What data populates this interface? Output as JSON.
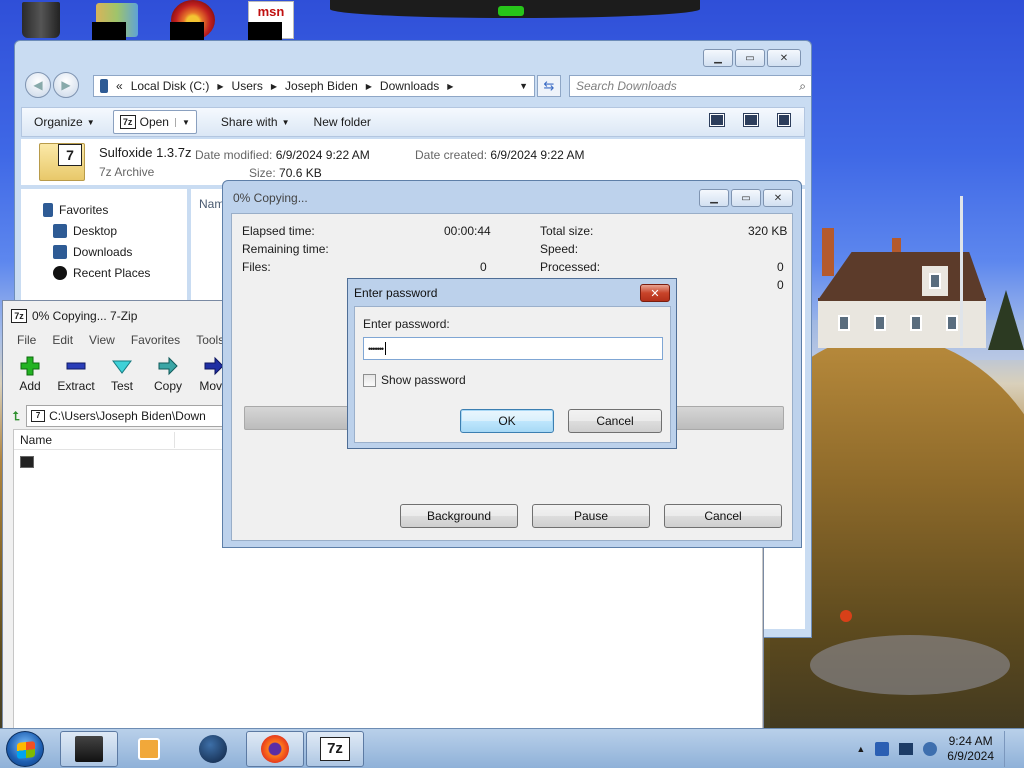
{
  "desktop": {
    "icons": [
      "recycle-bin",
      "books",
      "media-player",
      "msn"
    ],
    "msn_label": "msn"
  },
  "explorer": {
    "breadcrumbs": [
      "Local Disk (C:)",
      "Users",
      "Joseph Biden",
      "Downloads"
    ],
    "breadcrumb_prefix": "«",
    "search_placeholder": "Search Downloads",
    "commands": {
      "organize": "Organize",
      "open": "Open",
      "share_with": "Share with",
      "new_folder": "New folder"
    },
    "file": {
      "name": "Sulfoxide 1.3.7z",
      "type": "7z Archive",
      "date_modified_label": "Date modified:",
      "date_modified": "6/9/2024 9:22 AM",
      "date_created_label": "Date created:",
      "date_created": "6/9/2024 9:22 AM",
      "size_label": "Size:",
      "size": "70.6 KB"
    },
    "nav": {
      "favorites": "Favorites",
      "desktop": "Desktop",
      "downloads": "Downloads",
      "recent_places": "Recent Places"
    },
    "list_column": "Nam"
  },
  "zip_fm": {
    "title": "0% Copying... 7-Zip",
    "menu": [
      "File",
      "Edit",
      "View",
      "Favorites",
      "Tools"
    ],
    "toolbar": [
      "Add",
      "Extract",
      "Test",
      "Copy",
      "Move"
    ],
    "path": "C:\\Users\\Joseph Biden\\Down",
    "column_name": "Name"
  },
  "copy_dialog": {
    "title": "0% Copying...",
    "elapsed_label": "Elapsed time:",
    "elapsed_value": "00:00:44",
    "remaining_label": "Remaining time:",
    "files_label": "Files:",
    "files_value": "0",
    "total_size_label": "Total size:",
    "total_size_value": "320 KB",
    "speed_label": "Speed:",
    "processed_label": "Processed:",
    "processed_value": "0",
    "extra_value": "0",
    "progress_fraction": 0.0,
    "buttons": {
      "background": "Background",
      "pause": "Pause",
      "cancel": "Cancel"
    }
  },
  "password_dialog": {
    "title": "Enter password",
    "label": "Enter password:",
    "value": "•••••••",
    "show_password": "Show password",
    "ok": "OK",
    "cancel": "Cancel"
  },
  "taskbar": {
    "time": "9:24 AM",
    "date": "6/9/2024",
    "sevenzip_label": "7z",
    "tray_arrow": "▲"
  }
}
